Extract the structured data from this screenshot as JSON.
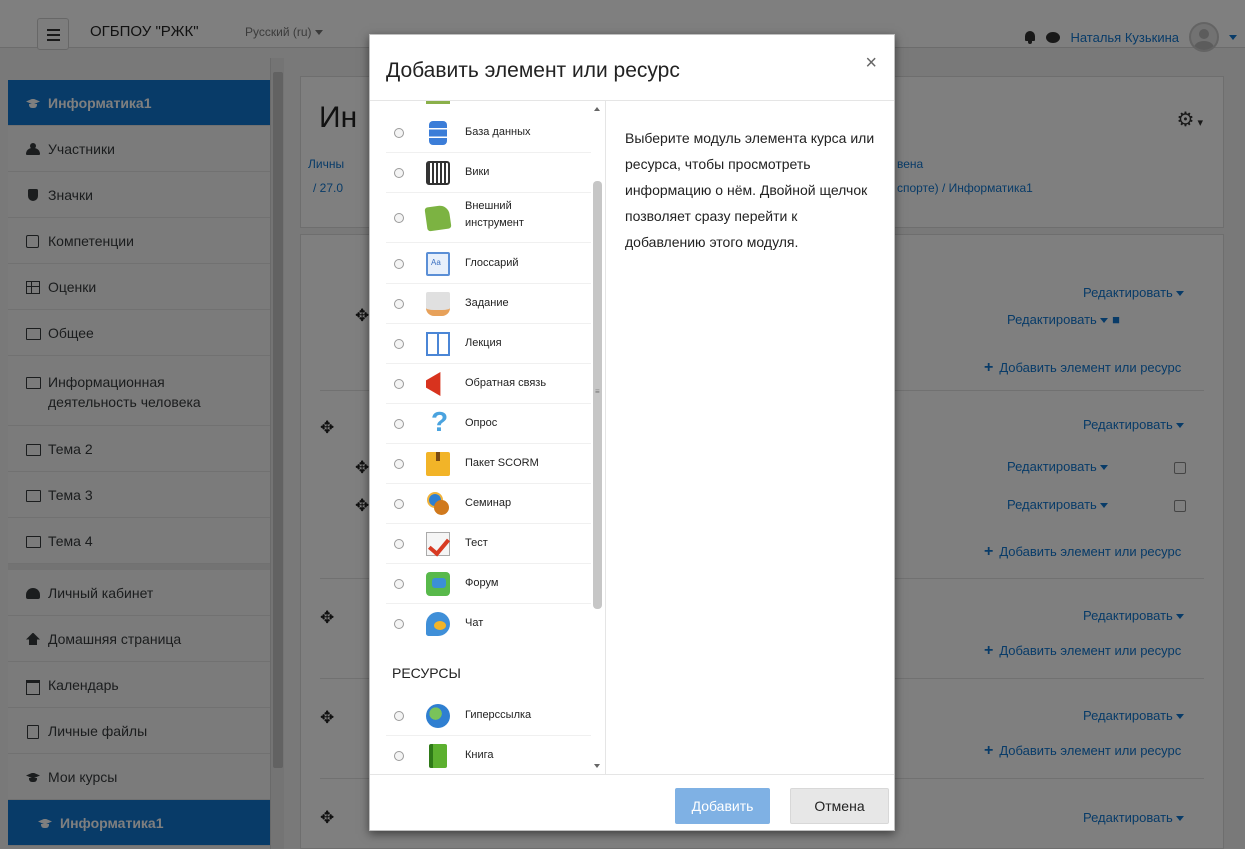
{
  "navbar": {
    "site_name": "ОГБПОУ \"РЖК\"",
    "language": "Русский (ru)",
    "user_name": "Наталья Кузькина"
  },
  "sidebar": {
    "items": [
      {
        "label": "Информатика1",
        "icon": "graduation-cap-icon",
        "active": true
      },
      {
        "label": "Участники",
        "icon": "users-icon"
      },
      {
        "label": "Значки",
        "icon": "shield-icon"
      },
      {
        "label": "Компетенции",
        "icon": "checkbox-icon"
      },
      {
        "label": "Оценки",
        "icon": "table-icon"
      },
      {
        "label": "Общее",
        "icon": "folder-icon"
      },
      {
        "label": "Информационная деятельность человека",
        "icon": "folder-icon"
      },
      {
        "label": "Тема 2",
        "icon": "folder-icon"
      },
      {
        "label": "Тема 3",
        "icon": "folder-icon"
      },
      {
        "label": "Тема 4",
        "icon": "folder-icon"
      }
    ],
    "nav_items": [
      {
        "label": "Личный кабинет",
        "icon": "dashboard-icon"
      },
      {
        "label": "Домашняя страница",
        "icon": "home-icon"
      },
      {
        "label": "Календарь",
        "icon": "calendar-icon"
      },
      {
        "label": "Личные файлы",
        "icon": "file-icon"
      },
      {
        "label": "Мои курсы",
        "icon": "graduation-cap-icon"
      },
      {
        "label": "Информатика1",
        "icon": "graduation-cap-icon",
        "active": true
      }
    ]
  },
  "course": {
    "title_partial": "Ин",
    "crumb_line1_left": "Личны",
    "crumb_line2_left": "/ 27.0",
    "crumb_line1_right": "вена",
    "crumb_line2_right": "спорте) / Информатика1",
    "edit_label": "Редактировать",
    "add_label": "Добавить элемент или ресурс"
  },
  "modal": {
    "title": "Добавить элемент или ресурс",
    "close": "×",
    "activities": [
      {
        "label": "База данных",
        "icon": "database-icon"
      },
      {
        "label": "Вики",
        "icon": "wiki-icon"
      },
      {
        "label": "Внешний инструмент",
        "icon": "puzzle-icon"
      },
      {
        "label": "Глоссарий",
        "icon": "glossary-icon"
      },
      {
        "label": "Задание",
        "icon": "assignment-icon"
      },
      {
        "label": "Лекция",
        "icon": "lesson-icon"
      },
      {
        "label": "Обратная связь",
        "icon": "megaphone-icon"
      },
      {
        "label": "Опрос",
        "icon": "question-icon"
      },
      {
        "label": "Пакет SCORM",
        "icon": "scorm-package-icon"
      },
      {
        "label": "Семинар",
        "icon": "workshop-icon"
      },
      {
        "label": "Тест",
        "icon": "quiz-icon"
      },
      {
        "label": "Форум",
        "icon": "forum-icon"
      },
      {
        "label": "Чат",
        "icon": "chat-icon"
      }
    ],
    "resources_heading": "РЕСУРСЫ",
    "resources": [
      {
        "label": "Гиперссылка",
        "icon": "url-icon"
      },
      {
        "label": "Книга",
        "icon": "book-icon"
      }
    ],
    "info_text": "Выберите модуль элемента курса или ресурса, чтобы просмотреть информацию о нём. Двойной щелчок позволяет сразу перейти к добавлению этого модуля.",
    "add_button": "Добавить",
    "cancel_button": "Отмена"
  },
  "colors": {
    "accent": "#1177d1",
    "add_button_bg": "#7fb1e4"
  }
}
